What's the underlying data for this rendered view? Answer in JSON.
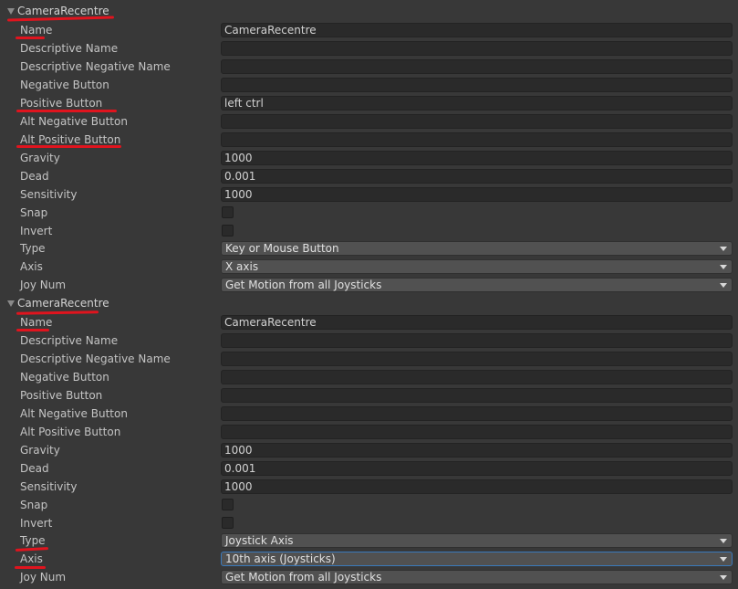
{
  "groups": [
    {
      "title": "CameraRecentre",
      "fields": {
        "name_label": "Name",
        "name_value": "CameraRecentre",
        "desc_label": "Descriptive Name",
        "desc_value": "",
        "descneg_label": "Descriptive Negative Name",
        "descneg_value": "",
        "neg_label": "Negative Button",
        "neg_value": "",
        "pos_label": "Positive Button",
        "pos_value": "left ctrl",
        "altneg_label": "Alt Negative Button",
        "altneg_value": "",
        "altpos_label": "Alt Positive Button",
        "altpos_value": "",
        "gravity_label": "Gravity",
        "gravity_value": "1000",
        "dead_label": "Dead",
        "dead_value": "0.001",
        "sens_label": "Sensitivity",
        "sens_value": "1000",
        "snap_label": "Snap",
        "snap_checked": false,
        "invert_label": "Invert",
        "invert_checked": false,
        "type_label": "Type",
        "type_value": "Key or Mouse Button",
        "axis_label": "Axis",
        "axis_value": "X axis",
        "joy_label": "Joy Num",
        "joy_value": "Get Motion from all Joysticks"
      }
    },
    {
      "title": "CameraRecentre",
      "fields": {
        "name_label": "Name",
        "name_value": "CameraRecentre",
        "desc_label": "Descriptive Name",
        "desc_value": "",
        "descneg_label": "Descriptive Negative Name",
        "descneg_value": "",
        "neg_label": "Negative Button",
        "neg_value": "",
        "pos_label": "Positive Button",
        "pos_value": "",
        "altneg_label": "Alt Negative Button",
        "altneg_value": "",
        "altpos_label": "Alt Positive Button",
        "altpos_value": "",
        "gravity_label": "Gravity",
        "gravity_value": "1000",
        "dead_label": "Dead",
        "dead_value": "0.001",
        "sens_label": "Sensitivity",
        "sens_value": "1000",
        "snap_label": "Snap",
        "snap_checked": false,
        "invert_label": "Invert",
        "invert_checked": false,
        "type_label": "Type",
        "type_value": "Joystick Axis",
        "axis_label": "Axis",
        "axis_value": "10th axis (Joysticks)",
        "joy_label": "Joy Num",
        "joy_value": "Get Motion from all Joysticks"
      }
    }
  ],
  "colors": {
    "annotation_red": "#e0141e",
    "focus_blue": "#3a79bb"
  },
  "icons": {
    "foldout": "foldout-triangle-icon",
    "dropdown": "chevron-down-icon"
  }
}
